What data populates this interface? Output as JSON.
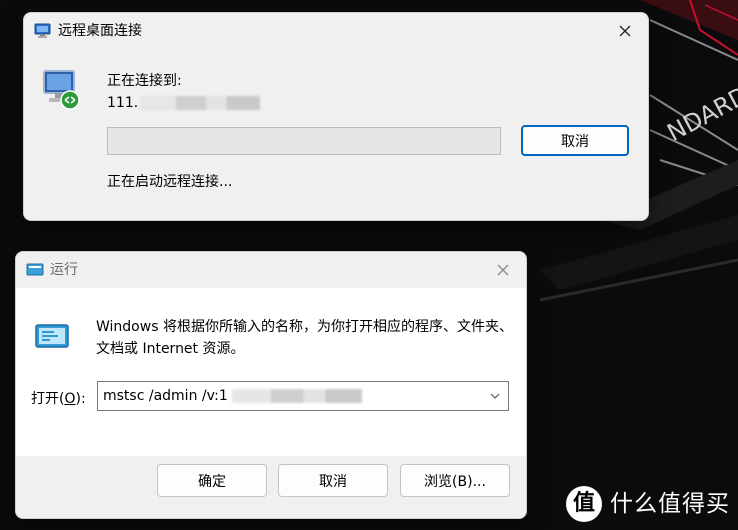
{
  "colors": {
    "accent": "#0067c0",
    "progress_fill": "#06b025",
    "window_bg": "#f0f0f0",
    "wallpaper_bg": "#0b0b0d",
    "wallpaper_accent": "#c8102e"
  },
  "wallpaper": {
    "text": "NDARD",
    "watermark_logo": "值",
    "watermark_text": "什么值得买"
  },
  "rdp_window": {
    "title": "远程桌面连接",
    "icon": "remote-desktop-icon",
    "connecting_label": "正在连接到:",
    "address_visible": "111.",
    "progress": 0,
    "cancel_label": "取消",
    "status": "正在启动远程连接..."
  },
  "run_window": {
    "title": "运行",
    "icon": "run-icon",
    "description": "Windows 将根据你所输入的名称，为你打开相应的程序、文件夹、文档或 Internet 资源。",
    "open_label_prefix": "打开(",
    "open_label_key": "O",
    "open_label_suffix": "):",
    "command_value": "mstsc /admin /v:1",
    "ok_label": "确定",
    "cancel_label": "取消",
    "browse_label": "浏览(B)..."
  }
}
